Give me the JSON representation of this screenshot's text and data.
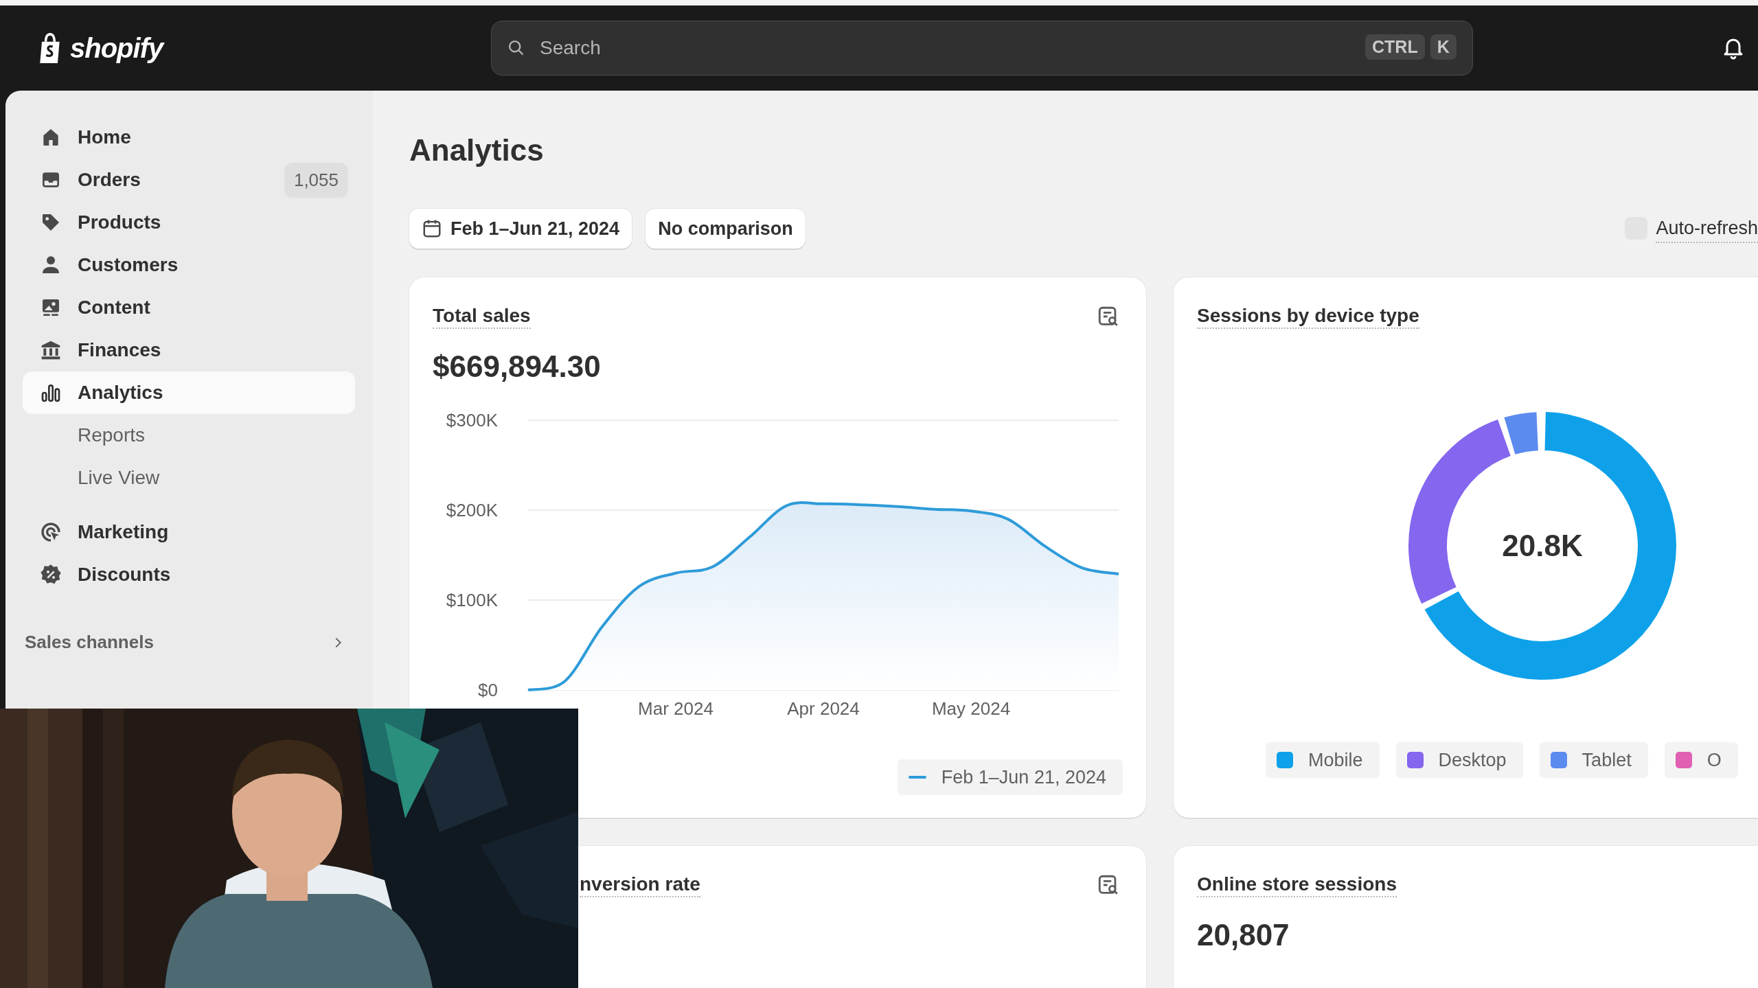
{
  "topbar": {
    "logo": "shopify",
    "search": {
      "placeholder": "Search",
      "shortcut": [
        "CTRL",
        "K"
      ]
    }
  },
  "sidebar": {
    "items": [
      {
        "label": "Home",
        "selected": false
      },
      {
        "label": "Orders",
        "badge": "1,055",
        "selected": false
      },
      {
        "label": "Products",
        "selected": false
      },
      {
        "label": "Customers",
        "selected": false
      },
      {
        "label": "Content",
        "selected": false
      },
      {
        "label": "Finances",
        "selected": false
      },
      {
        "label": "Analytics",
        "selected": true,
        "children": [
          {
            "label": "Reports",
            "selected": false
          },
          {
            "label": "Live View",
            "selected": false
          }
        ]
      },
      {
        "label": "Marketing",
        "selected": false
      },
      {
        "label": "Discounts",
        "selected": false
      }
    ],
    "section": {
      "label": "Sales channels"
    }
  },
  "page": {
    "title": "Analytics",
    "date_range": "Feb 1–Jun 21, 2024",
    "comparison": "No comparison",
    "auto_refresh": {
      "label": "Auto-refresh",
      "checked": false
    }
  },
  "cards": [
    {
      "title": "Total sales",
      "explore": true,
      "value": "$669,894.30",
      "chart_data": {
        "type": "line",
        "categories": [
          null,
          null,
          null,
          null,
          "Mar 2024",
          null,
          null,
          null,
          "Apr 2024",
          null,
          null,
          null,
          "May 2024",
          null,
          null,
          null,
          null
        ],
        "ylim": [
          0,
          300000
        ],
        "yticks": [
          {
            "value": 0,
            "label": "$0"
          },
          {
            "value": 100000,
            "label": "$100K"
          },
          {
            "value": 200000,
            "label": "$200K"
          },
          {
            "value": 300000,
            "label": "$300K"
          }
        ],
        "series": [
          {
            "name": "Feb 1–Jun 21, 2024",
            "color": "#2e9bd9",
            "values": [
              0,
              10000,
              70000,
              115000,
              130000,
              137000,
              170000,
              205000,
              207000,
              206000,
              204000,
              201000,
              199000,
              190000,
              160000,
              136000,
              129000
            ]
          }
        ]
      }
    },
    {
      "title": "Sessions by device type",
      "explore": false,
      "center_label": "20.8K",
      "legend": [
        {
          "label": "Mobile",
          "color": "#0ea1ea"
        },
        {
          "label": "Desktop",
          "color": "#8466ef"
        },
        {
          "label": "Tablet",
          "color": "#5b8bef"
        },
        {
          "label": "O",
          "color": "#e060b2"
        }
      ]
    },
    {
      "title": "nversion rate",
      "explore": true
    },
    {
      "title": "Online store sessions",
      "explore": false,
      "value": "20,807"
    }
  ]
}
